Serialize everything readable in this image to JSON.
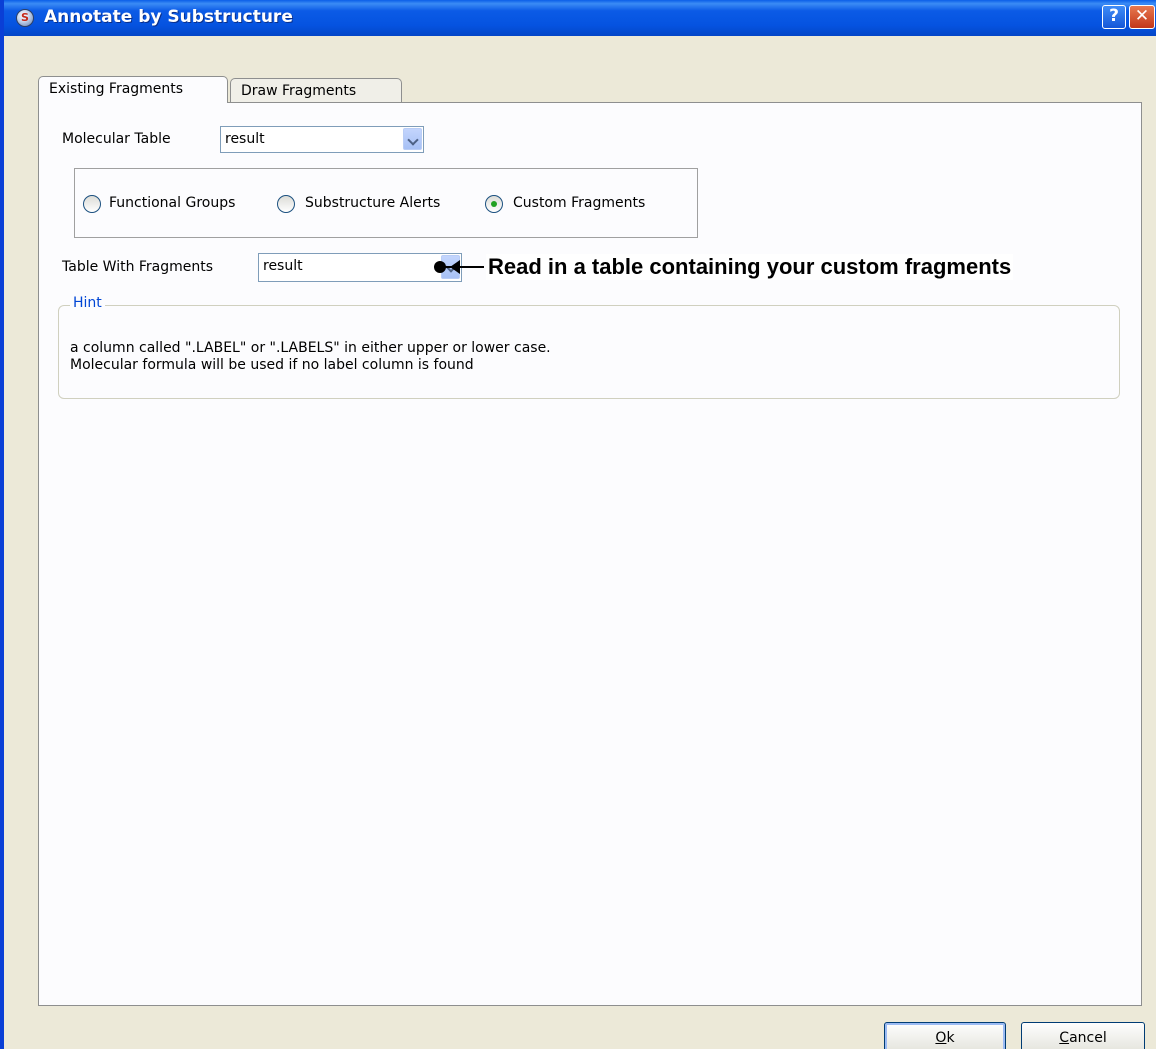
{
  "window": {
    "title": "Annotate by Substructure",
    "help_label": "?",
    "close_label": "✕"
  },
  "tabs": [
    {
      "label": "Existing Fragments",
      "selected": true
    },
    {
      "label": "Draw Fragments",
      "selected": false
    }
  ],
  "molecular_table": {
    "label": "Molecular Table",
    "value": "result"
  },
  "fragment_type": {
    "options": [
      {
        "label": "Functional Groups",
        "checked": false
      },
      {
        "label": "Substructure Alerts",
        "checked": false
      },
      {
        "label": "Custom Fragments",
        "checked": true
      }
    ]
  },
  "table_with_fragments": {
    "label": "Table With Fragments",
    "value": "result"
  },
  "annotation": {
    "text": "Read in a table containing your custom fragments"
  },
  "hint": {
    "title": "Hint",
    "lines": [
      "a column called \".LABEL\" or \".LABELS\" in either upper or lower case.",
      "Molecular formula will be used if no label column is found"
    ]
  },
  "buttons": {
    "ok": "Ok",
    "cancel": "Cancel"
  },
  "colors": {
    "titlebar": "#0553e0",
    "dialog_bg": "#ece9d8",
    "panel_bg": "#fcfcfe",
    "hint_title": "#0046d5",
    "radio_checked": "#21a121"
  }
}
